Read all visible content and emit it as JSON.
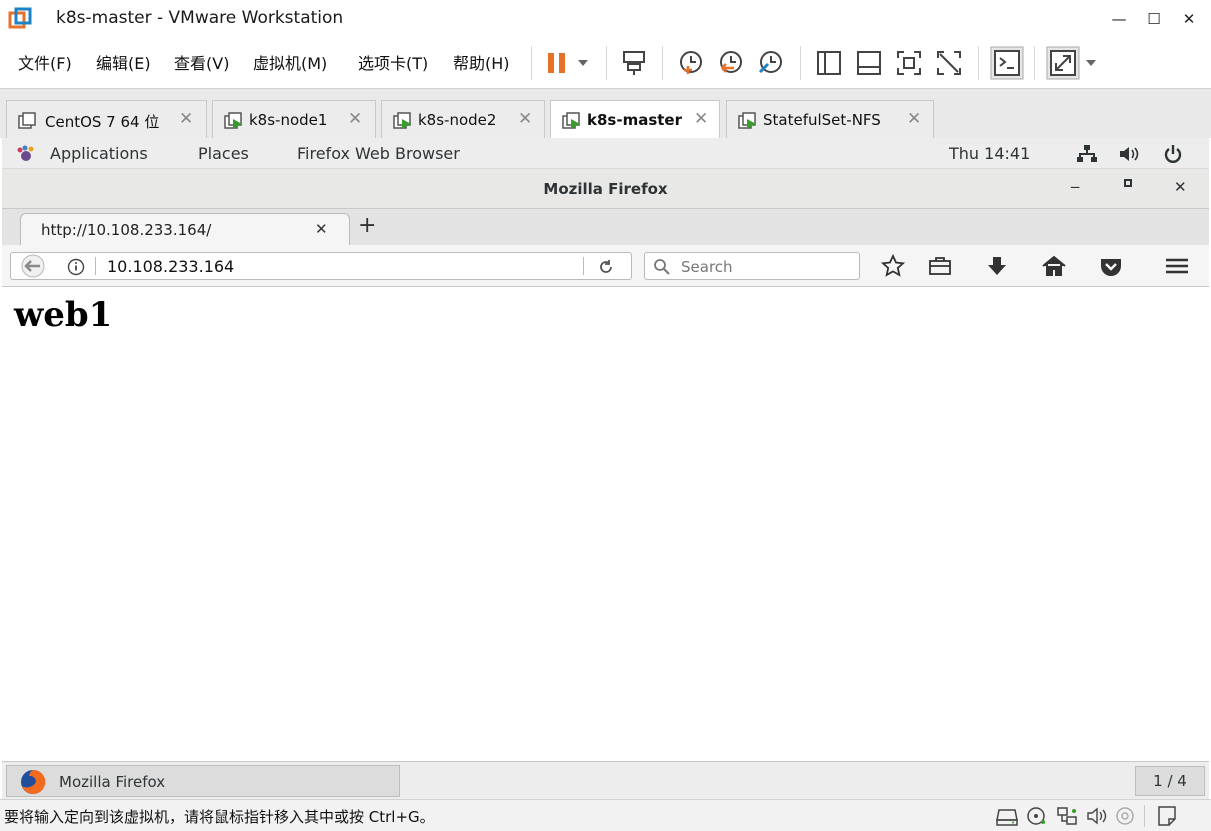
{
  "vmware": {
    "window_title": "k8s-master - VMware Workstation",
    "menu": [
      "文件(F)",
      "编辑(E)",
      "查看(V)",
      "虚拟机(M)",
      "选项卡(T)",
      "帮助(H)"
    ],
    "tabs": [
      {
        "label": "CentOS 7 64 位",
        "icon": "vm-icon"
      },
      {
        "label": "k8s-node1",
        "icon": "vm-running-icon"
      },
      {
        "label": "k8s-node2",
        "icon": "vm-running-icon"
      },
      {
        "label": "k8s-master",
        "icon": "vm-running-icon",
        "active": true
      },
      {
        "label": "StatefulSet-NFS",
        "icon": "vm-running-icon"
      }
    ],
    "status_message": "要将输入定向到该虚拟机，请将鼠标指针移入其中或按 Ctrl+G。",
    "accent_color": "#e8712a"
  },
  "gnome": {
    "applications": "Applications",
    "places": "Places",
    "app_name": "Firefox Web Browser",
    "clock": "Thu 14:41",
    "taskbar_window": "Mozilla Firefox",
    "workspace": "1 / 4"
  },
  "firefox": {
    "window_title": "Mozilla Firefox",
    "tab_title": "http://10.108.233.164/",
    "url": "10.108.233.164",
    "search_placeholder": "Search",
    "page_heading": "web1"
  }
}
